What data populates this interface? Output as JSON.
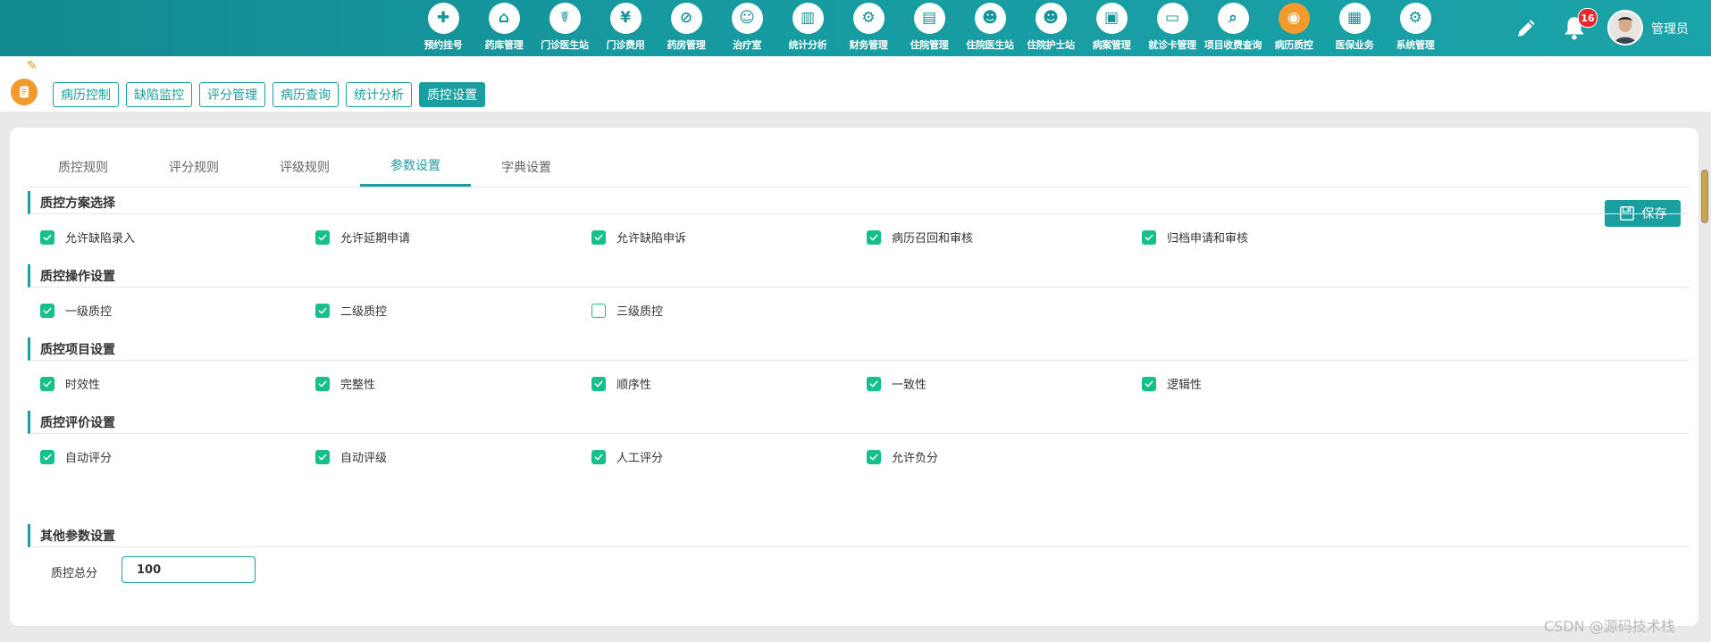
{
  "topnav": [
    {
      "label": "预约挂号",
      "icon": "calendar-plus-icon",
      "glyph": "✚"
    },
    {
      "label": "药库管理",
      "icon": "warehouse-icon",
      "glyph": "⌂"
    },
    {
      "label": "门诊医生站",
      "icon": "doctor-icon",
      "glyph": "☤"
    },
    {
      "label": "门诊费用",
      "icon": "yuan-icon",
      "glyph": "¥"
    },
    {
      "label": "药房管理",
      "icon": "pill-icon",
      "glyph": "⊘"
    },
    {
      "label": "治疗室",
      "icon": "nurse-icon",
      "glyph": "☺"
    },
    {
      "label": "统计分析",
      "icon": "bar-chart-icon",
      "glyph": "▥"
    },
    {
      "label": "财务管理",
      "icon": "finance-gear-icon",
      "glyph": "⚙"
    },
    {
      "label": "住院管理",
      "icon": "hospital-bed-icon",
      "glyph": "▤"
    },
    {
      "label": "住院医生站",
      "icon": "inpatient-doctor-icon",
      "glyph": "☻"
    },
    {
      "label": "住院护士站",
      "icon": "inpatient-nurse-icon",
      "glyph": "☻"
    },
    {
      "label": "病案管理",
      "icon": "case-file-icon",
      "glyph": "▣"
    },
    {
      "label": "就诊卡管理",
      "icon": "card-icon",
      "glyph": "▭"
    },
    {
      "label": "项目收费查询",
      "icon": "fee-search-icon",
      "glyph": "⌕"
    },
    {
      "label": "病历质控",
      "icon": "record-qc-icon",
      "glyph": "◉",
      "active": true
    },
    {
      "label": "医保业务",
      "icon": "insurance-card-icon",
      "glyph": "▦"
    },
    {
      "label": "系统管理",
      "icon": "settings-gear-icon",
      "glyph": "⚙"
    }
  ],
  "header": {
    "badge_count": "16",
    "username": "管理员",
    "edit_icon": "pencil-icon",
    "bell_icon": "bell-icon",
    "accent": "#1a9e9f"
  },
  "subtabs": [
    {
      "label": "病历控制"
    },
    {
      "label": "缺陷监控"
    },
    {
      "label": "评分管理"
    },
    {
      "label": "病历查询"
    },
    {
      "label": "统计分析"
    },
    {
      "label": "质控设置",
      "active": true
    }
  ],
  "tabs": [
    {
      "label": "质控规则"
    },
    {
      "label": "评分规则"
    },
    {
      "label": "评级规则"
    },
    {
      "label": "参数设置",
      "active": true
    },
    {
      "label": "字典设置"
    }
  ],
  "save_label": "保存",
  "sections": [
    {
      "title": "质控方案选择",
      "options": [
        {
          "label": "允许缺陷录入",
          "checked": true
        },
        {
          "label": "允许延期申请",
          "checked": true
        },
        {
          "label": "允许缺陷申诉",
          "checked": true
        },
        {
          "label": "病历召回和审核",
          "checked": true
        },
        {
          "label": "归档申请和审核",
          "checked": true
        }
      ]
    },
    {
      "title": "质控操作设置",
      "options": [
        {
          "label": "一级质控",
          "checked": true
        },
        {
          "label": "二级质控",
          "checked": true
        },
        {
          "label": "三级质控",
          "checked": false
        }
      ]
    },
    {
      "title": "质控项目设置",
      "options": [
        {
          "label": "时效性",
          "checked": true
        },
        {
          "label": "完整性",
          "checked": true
        },
        {
          "label": "顺序性",
          "checked": true
        },
        {
          "label": "一致性",
          "checked": true
        },
        {
          "label": "逻辑性",
          "checked": true
        }
      ]
    },
    {
      "title": "质控评价设置",
      "options": [
        {
          "label": "自动评分",
          "checked": true
        },
        {
          "label": "自动评级",
          "checked": true
        },
        {
          "label": "人工评分",
          "checked": true
        },
        {
          "label": "允许负分",
          "checked": true
        }
      ]
    }
  ],
  "other": {
    "title": "其他参数设置",
    "score_label": "质控总分",
    "score_value": "100"
  },
  "watermark": "CSDN @源码技术栈"
}
